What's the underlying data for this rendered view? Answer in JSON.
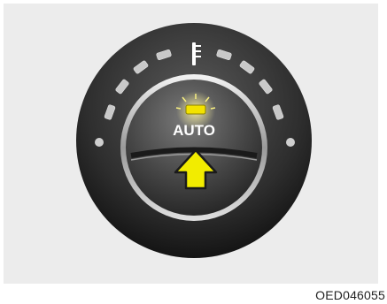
{
  "knob": {
    "button_label": "AUTO",
    "indicator_state": "lit",
    "indicator_color": "#f3e300",
    "arrow_color": "#f2ec00",
    "arrow_icon": "arrow-up-icon",
    "thermometer_icon": "thermometer-icon"
  },
  "figure_code": "OED046055"
}
